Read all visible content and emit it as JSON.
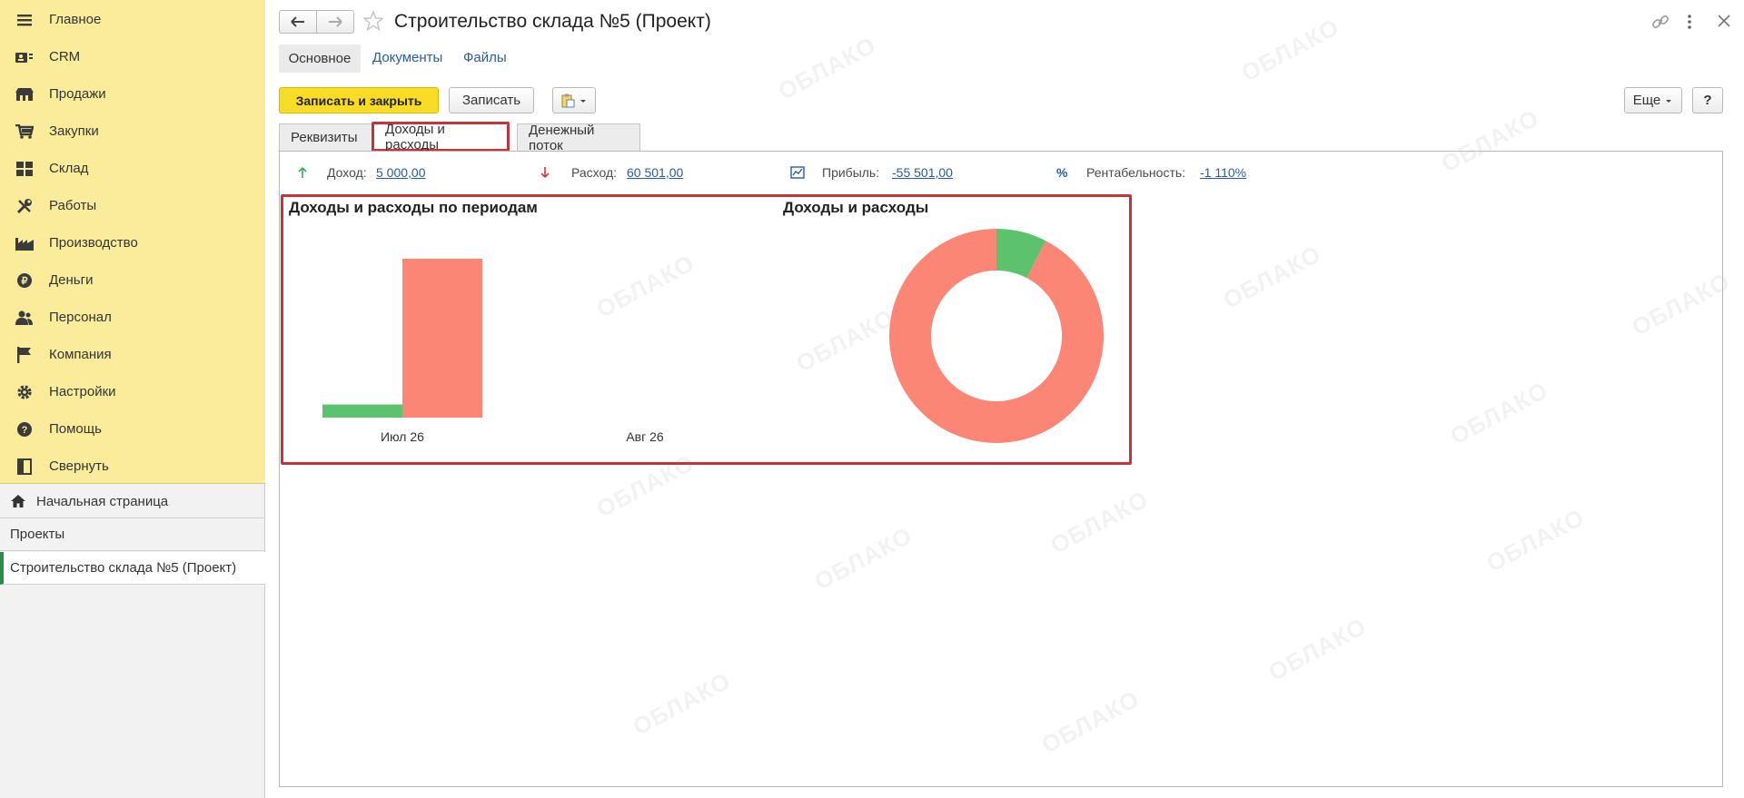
{
  "sidebar": {
    "items": [
      {
        "label": "Главное",
        "icon": "menu-icon"
      },
      {
        "label": "CRM",
        "icon": "crm-icon"
      },
      {
        "label": "Продажи",
        "icon": "sales-icon"
      },
      {
        "label": "Закупки",
        "icon": "cart-icon"
      },
      {
        "label": "Склад",
        "icon": "warehouse-icon"
      },
      {
        "label": "Работы",
        "icon": "tools-icon"
      },
      {
        "label": "Производство",
        "icon": "factory-icon"
      },
      {
        "label": "Деньги",
        "icon": "money-icon"
      },
      {
        "label": "Персонал",
        "icon": "staff-icon"
      },
      {
        "label": "Компания",
        "icon": "flag-icon"
      },
      {
        "label": "Настройки",
        "icon": "gear-icon"
      },
      {
        "label": "Помощь",
        "icon": "help-icon"
      },
      {
        "label": "Свернуть",
        "icon": "collapse-icon"
      }
    ],
    "home_label": "Начальная страница",
    "open_windows": [
      "Проекты",
      "Строительство склада №5 (Проект)"
    ]
  },
  "header": {
    "title": "Строительство склада №5 (Проект)"
  },
  "section_tabs": [
    "Основное",
    "Документы",
    "Файлы"
  ],
  "toolbar": {
    "save_close": "Записать и закрыть",
    "save": "Записать",
    "more": "Еще",
    "help": "?"
  },
  "form_tabs": [
    "Реквизиты",
    "Доходы и расходы",
    "Денежный поток"
  ],
  "kpis": {
    "income_label": "Доход:",
    "income_value": "5 000,00",
    "expense_label": "Расход:",
    "expense_value": "60 501,00",
    "profit_label": "Прибыль:",
    "profit_value": "-55 501,00",
    "rent_label": "Рентабельность:",
    "rent_value": "-1 110%"
  },
  "colors": {
    "income": "#5dc26e",
    "expense": "#fc8676",
    "accent_yellow": "#f8dc26",
    "highlight": "#c8323a",
    "link": "#2a5b9e"
  },
  "watermark": "ОБЛАКО",
  "chart_data": [
    {
      "type": "bar",
      "title": "Доходы и расходы по периодам",
      "categories": [
        "Июл 26",
        "Авг 26"
      ],
      "series": [
        {
          "values": [
            5000,
            0
          ],
          "color": "#5dc26e"
        },
        {
          "values": [
            60501,
            0
          ],
          "color": "#fc8676"
        }
      ],
      "ylim": [
        0,
        60501
      ]
    },
    {
      "type": "pie",
      "title": "Доходы и расходы",
      "donut": true,
      "values": [
        5000,
        60501
      ],
      "colors": [
        "#5dc26e",
        "#fc8676"
      ]
    }
  ]
}
